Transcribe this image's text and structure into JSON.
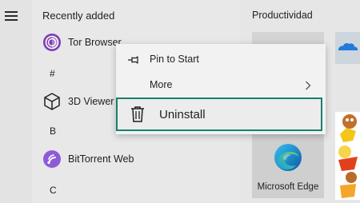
{
  "start_menu": {
    "recent_header": "Recently added",
    "apps": [
      {
        "label": "Tor Browser",
        "icon": "tor-browser-icon"
      },
      {
        "label": "3D Viewer",
        "icon": "3d-viewer-icon"
      },
      {
        "label": "BitTorrent Web",
        "icon": "bittorrent-web-icon"
      }
    ],
    "letters": [
      "#",
      "B",
      "C"
    ]
  },
  "context_menu": {
    "items": [
      {
        "label": "Pin to Start",
        "icon": "pin-icon"
      },
      {
        "label": "More",
        "icon": "chevron-right-icon"
      },
      {
        "label": "Uninstall",
        "icon": "trash-icon"
      }
    ],
    "highlight_color": "#17806b"
  },
  "tiles": {
    "group_title": "Productividad",
    "edge_label": "Microsoft Edge"
  }
}
